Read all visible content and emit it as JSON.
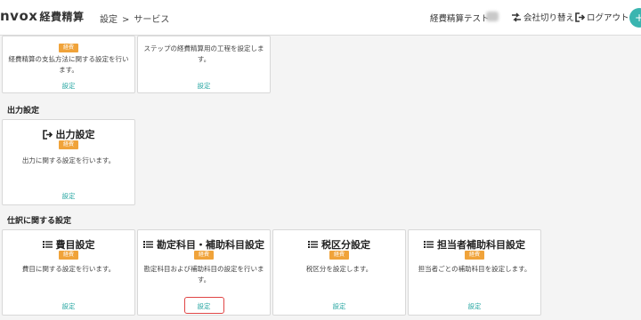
{
  "header": {
    "logo_main": "nvox",
    "logo_sub": "経費精算",
    "breadcrumb": [
      "設定",
      "サービス"
    ],
    "breadcrumb_sep": ">",
    "user_name": "経費精算テスト",
    "switch_company": "会社切り替え",
    "logout": "ログアウト"
  },
  "top_cards": [
    {
      "desc": "経費精算の支払方法に関する設定を行います。",
      "badge": "経費",
      "link": "設定"
    },
    {
      "desc": "ステップの経費精算用の工程を設定します。",
      "link": "設定"
    }
  ],
  "output_section": {
    "title": "出力設定",
    "cards": [
      {
        "title": "出力設定",
        "badge": "経費",
        "desc": "出力に関する設定を行います。",
        "link": "設定"
      }
    ]
  },
  "journal_section": {
    "title": "仕訳に関する設定",
    "cards": [
      {
        "title": "費目設定",
        "badge": "経費",
        "desc": "費目に関する設定を行います。",
        "link": "設定"
      },
      {
        "title": "勘定科目・補助科目設定",
        "badge": "経費",
        "desc": "勘定科目および補助科目の設定を行います。",
        "link": "設定"
      },
      {
        "title": "税区分設定",
        "badge": "経費",
        "desc": "税区分を設定します。",
        "link": "設定"
      },
      {
        "title": "担当者補助科目設定",
        "badge": "経費",
        "desc": "担当者ごとの補助科目を設定します。",
        "link": "設定"
      }
    ]
  },
  "colors": {
    "accent": "#2aa7a3",
    "badge": "#f0a33a",
    "highlight": "#e04545"
  }
}
